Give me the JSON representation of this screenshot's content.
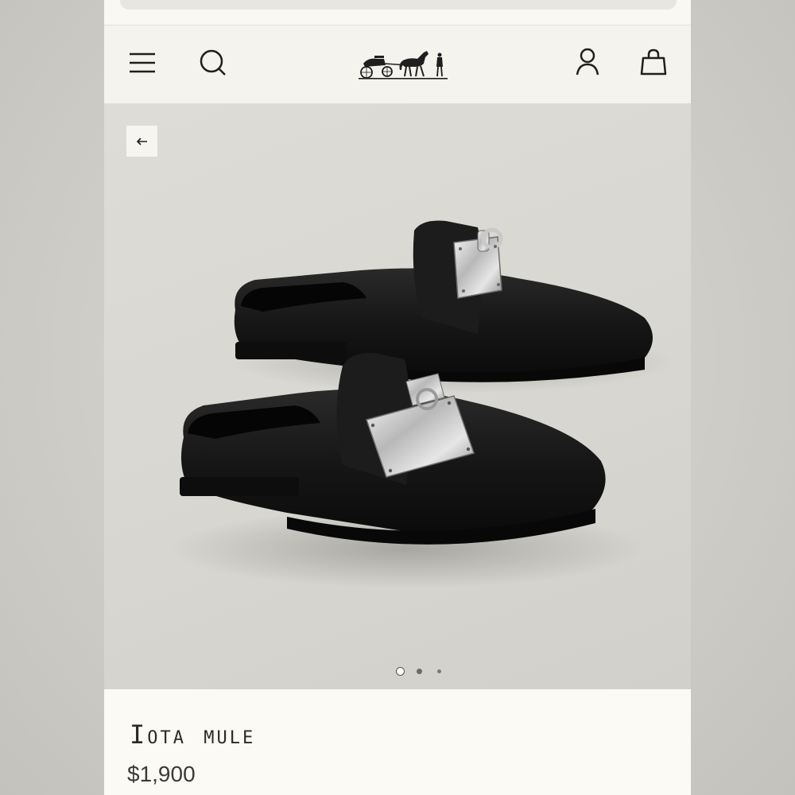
{
  "header": {
    "icons": {
      "menu": "hamburger-menu-icon",
      "search": "search-icon",
      "logo": "hermes-carriage-logo",
      "account": "user-icon",
      "cart": "shopping-bag-icon"
    }
  },
  "gallery": {
    "back": "arrow-left-icon",
    "image": "black leather mules with silver Kelly buckle",
    "active_index": 1,
    "count": 3
  },
  "product": {
    "name": "Iota mule",
    "price": "$1,900"
  },
  "colors": {
    "header_bg": "#f5f3ee",
    "media_bg": "#dedcd6",
    "text": "#2a2a2a"
  }
}
